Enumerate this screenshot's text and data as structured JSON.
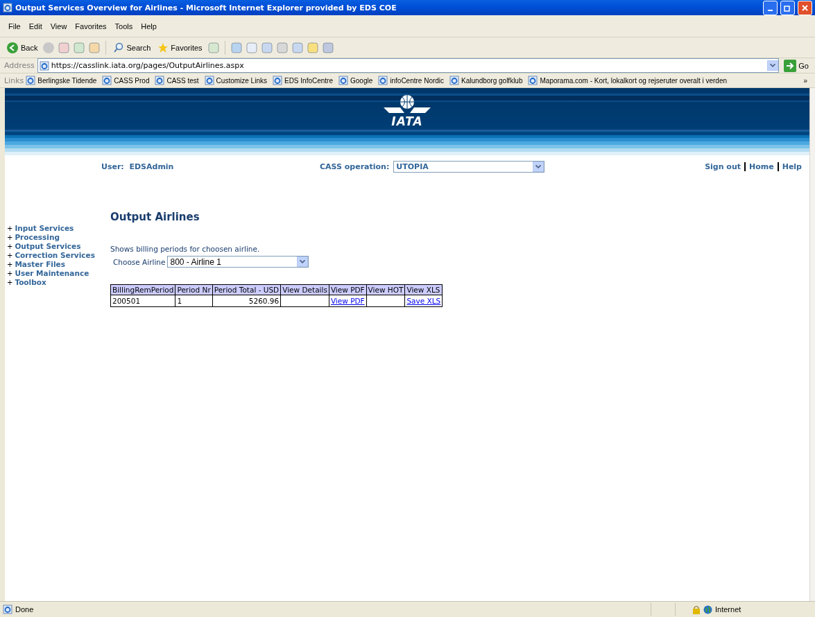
{
  "window": {
    "title": "Output Services Overview for Airlines - Microsoft Internet Explorer provided by EDS COE"
  },
  "menu": [
    "File",
    "Edit",
    "View",
    "Favorites",
    "Tools",
    "Help"
  ],
  "toolbar": {
    "back": "Back",
    "search": "Search",
    "favorites": "Favorites"
  },
  "address": {
    "label": "Address",
    "value": "https://casslink.iata.org/pages/OutputAirlines.aspx",
    "go": "Go"
  },
  "links": {
    "label": "Links",
    "more": "»",
    "items": [
      "Berlingske Tidende",
      "CASS Prod",
      "CASS test",
      "Customize Links",
      "EDS InfoCentre",
      "Google",
      "infoCentre Nordic",
      "Kalundborg golfklub",
      "Maporama.com - Kort, lokalkort og rejseruter overalt i verden"
    ]
  },
  "header": {
    "logo": "IATA"
  },
  "userbar": {
    "user_label": "User:",
    "user": "EDSAdmin",
    "operation_label": "CASS operation:",
    "operation": "UTOPIA",
    "links": [
      "Sign out",
      "Home",
      "Help"
    ]
  },
  "nav": [
    {
      "marker": "+",
      "label": "Input Services"
    },
    {
      "marker": "+",
      "label": "Processing"
    },
    {
      "marker": "+",
      "label": "Output Services"
    },
    {
      "marker": "+",
      "label": "Correction Services"
    },
    {
      "marker": "+",
      "label": "Master Files"
    },
    {
      "marker": "+",
      "label": "User Maintenance"
    },
    {
      "marker": "+",
      "label": "Toolbox"
    }
  ],
  "page": {
    "title": "Output Airlines",
    "description": "Shows billing periods for choosen airline.",
    "airline_label": "Choose Airline",
    "airline": "800 - Airline 1"
  },
  "table": {
    "columns": [
      "BillingRemPeriod",
      "Period Nr",
      "Period Total - USD",
      "View Details",
      "View PDF",
      "View HOT",
      "View XLS"
    ],
    "rows": [
      {
        "cells": [
          {
            "kind": "text",
            "text": "200501"
          },
          {
            "kind": "text",
            "text": "1"
          },
          {
            "kind": "number",
            "text": "5260.96"
          },
          {
            "kind": "empty"
          },
          {
            "kind": "link",
            "text": "View PDF"
          },
          {
            "kind": "empty"
          },
          {
            "kind": "link",
            "text": "Save XLS"
          }
        ]
      }
    ]
  },
  "status_bar": {
    "text": "Done",
    "zone": "Internet"
  }
}
